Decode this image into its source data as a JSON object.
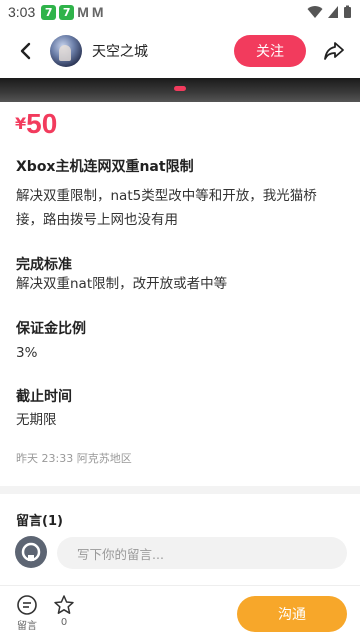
{
  "statusbar": {
    "time": "3:03",
    "app1": "7",
    "app2": "7",
    "m1": "M",
    "m2": "M"
  },
  "header": {
    "username": "天空之城",
    "follow_label": "关注"
  },
  "post": {
    "currency": "¥",
    "price": "50",
    "title": "Xbox主机连网双重nat限制",
    "description": "解决双重限制，nat5类型改中等和开放，我光猫桥接，路由拨号上网也没有用",
    "sections": [
      {
        "title": "完成标准",
        "text": "解决双重nat限制，改开放或者中等"
      },
      {
        "title": "保证金比例",
        "text": "3%"
      },
      {
        "title": "截止时间",
        "text": "无期限"
      }
    ],
    "meta": "昨天 23:33 阿克苏地区"
  },
  "comments": {
    "title": "留言(1)",
    "placeholder": "写下你的留言..."
  },
  "bottom": {
    "message_label": "留言",
    "favorite_count": "0",
    "chat_label": "沟通"
  },
  "colors": {
    "accent": "#f23b5d",
    "chat": "#f7a72a"
  }
}
